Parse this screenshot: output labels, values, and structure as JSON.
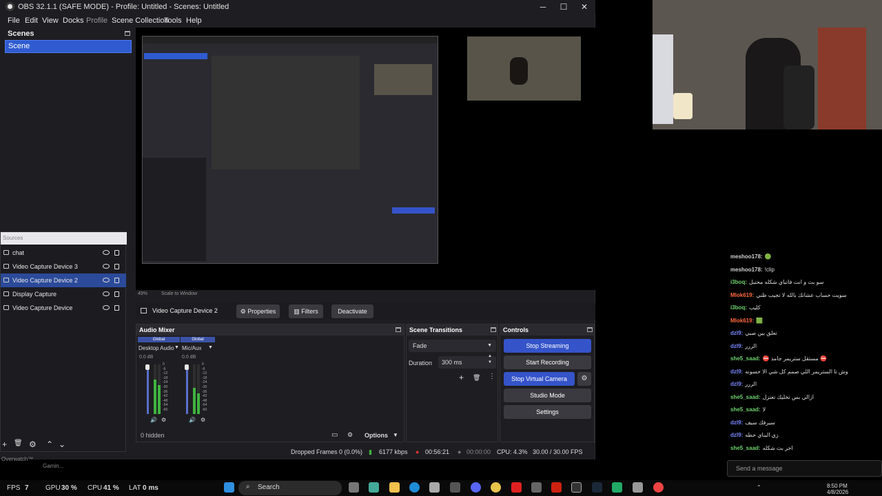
{
  "window": {
    "title": "OBS 32.1.1 (SAFE MODE) - Profile: Untitled - Scenes: Untitled",
    "minimize": "─",
    "maximize": "☐",
    "close": "✕"
  },
  "menu": [
    "File",
    "Edit",
    "View",
    "Docks",
    "Profile",
    "Scene Collection",
    "Tools",
    "Help"
  ],
  "scenes": {
    "header": "Scenes",
    "items": [
      "Scene"
    ]
  },
  "sources": {
    "header": "Sources",
    "items": [
      {
        "label": "chat",
        "selected": false
      },
      {
        "label": "Video Capture Device 3",
        "selected": false
      },
      {
        "label": "Video Capture Device 2",
        "selected": true
      },
      {
        "label": "Display Capture",
        "selected": false
      },
      {
        "label": "Video Capture Device",
        "selected": false
      }
    ],
    "toolbar": [
      "+",
      "🗑",
      "⚙",
      "⌃",
      "⌄"
    ]
  },
  "source_bar": {
    "current": "Video Capture Device 2",
    "properties": "Properties",
    "filters": "Filters",
    "deactivate": "Deactivate"
  },
  "audio_mixer": {
    "title": "Audio Mixer",
    "channels": [
      {
        "tag": "Global",
        "name": "Desktop Audio",
        "db": "0.0 dB"
      },
      {
        "tag": "Global",
        "name": "Mic/Aux",
        "db": "0.0 dB"
      }
    ],
    "scale": [
      "0",
      "-6",
      "-12",
      "-18",
      "-24",
      "-30",
      "-36",
      "-42",
      "-48",
      "-54",
      "-60"
    ],
    "hidden": "0 hidden",
    "options": "Options"
  },
  "scene_transitions": {
    "title": "Scene Transitions",
    "transition": "Fade",
    "duration_label": "Duration",
    "duration_value": "300 ms"
  },
  "controls": {
    "title": "Controls",
    "buttons": [
      "Stop Streaming",
      "Start Recording",
      "Stop Virtual Camera",
      "Studio Mode",
      "Settings"
    ]
  },
  "status": {
    "dropped": "Dropped Frames 0 (0.0%)",
    "kbps": "6177 kbps",
    "stream_time": "00:56:21",
    "rec_time": "00:00:00",
    "cpu": "CPU: 4.3%",
    "fps": "30.00 / 30.00 FPS"
  },
  "chat": {
    "lines": [
      {
        "user": "meshoo178:",
        "msg": "🟢",
        "color": "#d0d0d0"
      },
      {
        "user": "meshoo178:",
        "msg": "!clip",
        "color": "#d0d0d0"
      },
      {
        "user": "i3boq:",
        "msg": "سو بث و انت فاتباي شكله محتبل",
        "color": "#6fd36f"
      },
      {
        "user": "Mlok619:",
        "msg": "سويت حساب عشانك بالله لا تجيب ظني",
        "color": "#ff6a3d"
      },
      {
        "user": "i3boq:",
        "msg": "كليب",
        "color": "#6fd36f"
      },
      {
        "user": "Mlok619:",
        "msg": "🟩",
        "color": "#ff6a3d"
      },
      {
        "user": "dzl9:",
        "msg": "تعلق بين صبي",
        "color": "#7a87ff"
      },
      {
        "user": "dzl9:",
        "msg": "الررر",
        "color": "#7a87ff"
      },
      {
        "user": "she5_saad:",
        "msg": "⛔ مستقل ستريمر جامد ⛔",
        "color": "#6fd36f"
      },
      {
        "user": "dzl9:",
        "msg": "وش تا الستريمر اللي صمم كل شي الا حسونه",
        "color": "#7a87ff"
      },
      {
        "user": "dzl9:",
        "msg": "الررر",
        "color": "#7a87ff"
      },
      {
        "user": "she5_saad:",
        "msg": "ازالي بس تخليك تعتزل",
        "color": "#6fd36f"
      },
      {
        "user": "she5_saad:",
        "msg": "لا",
        "color": "#6fd36f"
      },
      {
        "user": "dzl9:",
        "msg": "سيرفك سيف",
        "color": "#7a87ff"
      },
      {
        "user": "dzl9:",
        "msg": "زي البناي حطه",
        "color": "#7a87ff"
      },
      {
        "user": "she5_saad:",
        "msg": "اخر بث شكله",
        "color": "#6fd36f"
      }
    ],
    "send_placeholder": "Send a message"
  },
  "perf": {
    "fps_label": "FPS",
    "fps_value": "7",
    "gpu_label": "GPU",
    "gpu_value": "30 %",
    "cpu_label": "CPU",
    "cpu_value": "41 %",
    "lat_label": "LAT",
    "lat_value": "0 ms"
  },
  "taskbar": {
    "search": "Search",
    "time": "8:50 PM",
    "date": "4/8/2026"
  },
  "overwatch": {
    "line1": "Overwatch™",
    "line2": "Gamin..."
  },
  "colors": {
    "accent": "#3554c9",
    "panel": "#1e1e22",
    "meter_green": "#3fb43f"
  }
}
